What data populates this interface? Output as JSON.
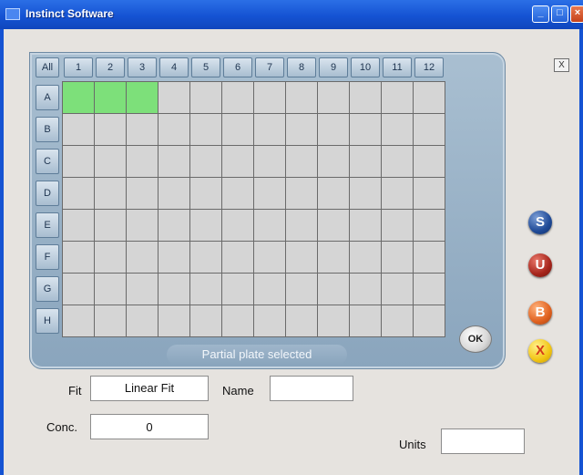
{
  "window": {
    "title": "Instinct Software"
  },
  "plate": {
    "all_label": "All",
    "columns": [
      "1",
      "2",
      "3",
      "4",
      "5",
      "6",
      "7",
      "8",
      "9",
      "10",
      "11",
      "12"
    ],
    "rows": [
      "A",
      "B",
      "C",
      "D",
      "E",
      "F",
      "G",
      "H"
    ],
    "selected_wells": [
      "A1",
      "A2",
      "A3"
    ],
    "status": "Partial plate selected",
    "ok_label": "OK",
    "close_label": "X"
  },
  "side_buttons": [
    {
      "label": "S",
      "color": "#1f4a97"
    },
    {
      "label": "U",
      "color": "#a6251c"
    },
    {
      "label": "B",
      "color": "#e0611f"
    },
    {
      "label": "X",
      "color": "#f2c514"
    }
  ],
  "form": {
    "fit_label": "Fit",
    "fit_value": "Linear Fit",
    "name_label": "Name",
    "name_value": "",
    "conc_label": "Conc.",
    "conc_value": "0",
    "units_label": "Units",
    "units_value": ""
  },
  "colors": {
    "selected_well": "#7de07a",
    "empty_well": "#d5d5d5",
    "panel": "#9fb6cb",
    "titlebar": "#1553d3"
  }
}
